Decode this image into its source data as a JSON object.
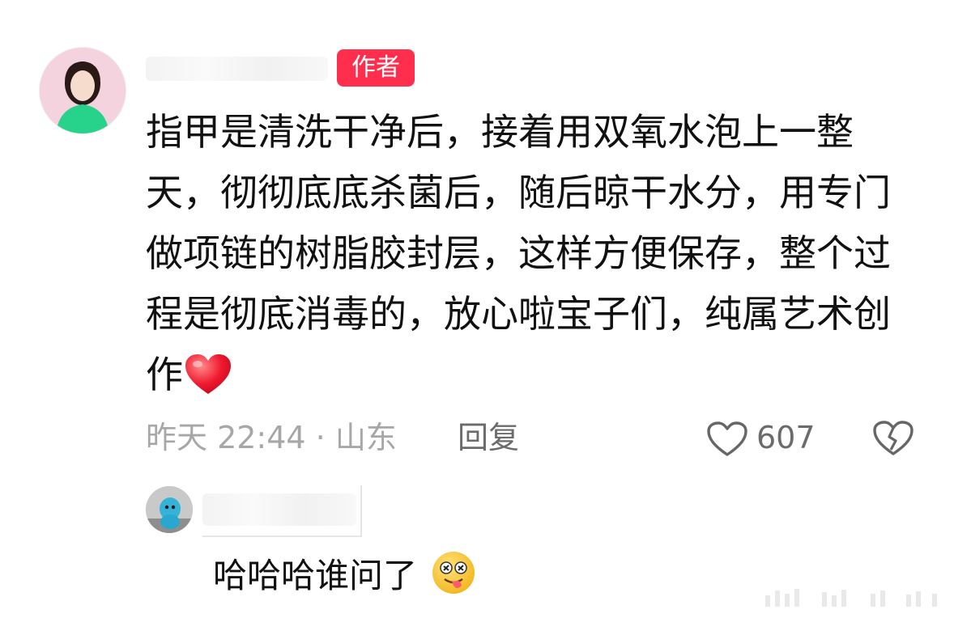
{
  "comment": {
    "author_tag": "作者",
    "text": "指甲是清洗干净后，接着用双氧水泡上一整天，彻彻底底杀菌后，随后晾干水分，用专门做项链的树脂胶封层，这样方便保存，整个过程是彻底消毒的，放心啦宝子们，纯属艺术创作",
    "emoji": "red-heart-emoji",
    "time_location": "昨天 22:44 · 山东",
    "reply_label": "回复",
    "like_count": "607",
    "like_icon": "heart-outline-icon",
    "dislike_icon": "broken-heart-icon"
  },
  "reply": {
    "text": "哈哈哈谁问了",
    "emoji": "tongue-out-emoji"
  },
  "colors": {
    "tag_bg": "#ff2e4d",
    "meta_text": "#a7a7a7",
    "action_text": "#6b6b6b"
  }
}
